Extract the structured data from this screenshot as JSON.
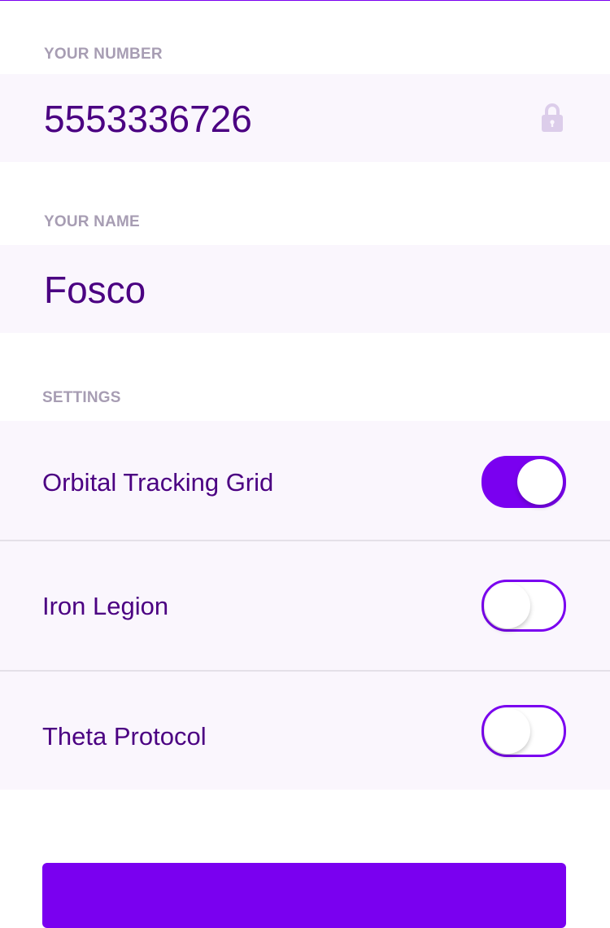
{
  "number_section": {
    "label": "YOUR NUMBER",
    "value": "5553336726",
    "icon": "lock-icon"
  },
  "name_section": {
    "label": "YOUR NAME",
    "value": "Fosco"
  },
  "settings": {
    "label": "SETTINGS",
    "items": [
      {
        "label": "Orbital Tracking Grid",
        "enabled": true
      },
      {
        "label": "Iron Legion",
        "enabled": false
      },
      {
        "label": "Theta Protocol",
        "enabled": false
      }
    ]
  },
  "colors": {
    "accent": "#7a00f0",
    "text": "#4b0082",
    "label": "#a79db3",
    "row_background": "#faf6fd"
  }
}
